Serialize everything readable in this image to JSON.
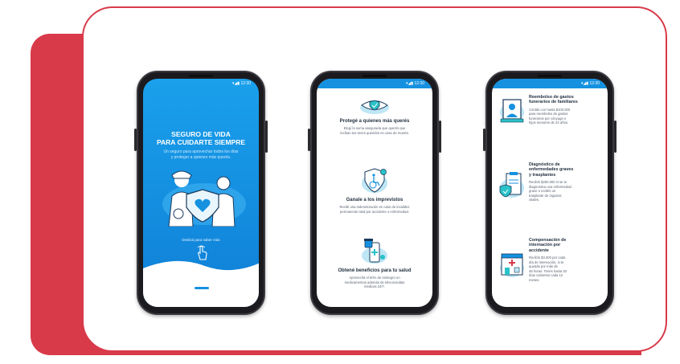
{
  "colors": {
    "brand_red": "#d83a4a",
    "brand_blue": "#1591e0",
    "dark_blue": "#0f7fd6",
    "teal": "#29c2c8"
  },
  "status_bar": {
    "time": "12:30"
  },
  "phone1": {
    "title_line1": "SEGURO DE VIDA",
    "title_line2": "PARA CUIDARTE SIEMPRE",
    "subtitle_line1": "Un seguro para aprovechar todos los días",
    "subtitle_line2": "y proteger a quienes más querés.",
    "hint": "Deslizá para saber más",
    "icon": "tap-hand-icon"
  },
  "phone2": {
    "sections": [
      {
        "icon": "eye-shield-icon",
        "title": "Protegé a quienes más querés",
        "text_line1": "Elegí la suma asegurada que querés que",
        "text_line2": "reciban tus seres queridos en caso de muerte."
      },
      {
        "icon": "wheelchair-shield-icon",
        "title": "Ganale a los imprevistos",
        "text_line1": "Recibí una indemnización en caso de invalidez",
        "text_line2": "permanente total por accidente o enfermedad."
      },
      {
        "icon": "medicine-phone-icon",
        "title": "Obtené beneficios para tu salud",
        "text_line1": "Aprovechá el 50% de reintegro en",
        "text_line2": "medicamentos además de teleconsultas",
        "text_line3": "médicas 24/7."
      }
    ]
  },
  "phone3": {
    "rows": [
      {
        "icon": "portrait-frame-icon",
        "title_line1": "Reembolso de gastos",
        "title_line2": "funerarios de familiares",
        "text_line1": "Contás con hasta $100.000",
        "text_line2": "para reembolso de gastos",
        "text_line3": "funerarios por cónyuge e",
        "text_line4": "hijos menores de 24 años."
      },
      {
        "icon": "medical-chart-icon",
        "title_line1": "Diagnóstico de",
        "title_line2": "enfermedades graves",
        "title_line3": "y trasplantes",
        "text_line1": "Recibís $200.000 si se te",
        "text_line2": "diagnostica una enfermedad",
        "text_line3": "grave o recibís un",
        "text_line4": "trasplante de órganos",
        "text_line5": "vitales."
      },
      {
        "icon": "hospital-icon",
        "title_line1": "Compensación de",
        "title_line2": "internación por",
        "title_line3": "accidente",
        "text_line1": "Recibís $3.000 por cada",
        "text_line2": "día de internación, si te",
        "text_line3": "quedás por más de",
        "text_line4": "48 horas. Tenés hasta 30",
        "text_line5": "días cubiertos cada 12",
        "text_line6": "meses."
      }
    ]
  }
}
